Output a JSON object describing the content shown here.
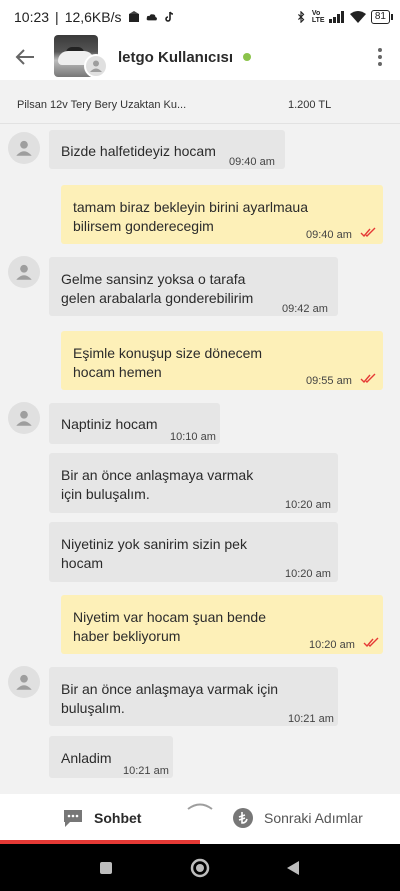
{
  "status_bar": {
    "time": "10:23",
    "network_speed": "12,6KB/s",
    "network_type": "Vo LTE",
    "battery": "81"
  },
  "header": {
    "user_name": "letgo Kullanıcısı",
    "online_color": "#8bc34a"
  },
  "listing": {
    "title": "Pilsan 12v Tery Bery Uzaktan Ku...",
    "price": "1.200 TL"
  },
  "messages": [
    {
      "direction": "in",
      "text": "Bizde halfetideyiz hocam",
      "time": "09:40 am"
    },
    {
      "direction": "out",
      "text": "tamam biraz bekleyin birini ayarlmaua bilirsem gonderecegim",
      "time": "09:40 am",
      "read": true
    },
    {
      "direction": "in",
      "text": "Gelme sansinz yoksa o tarafa gelen arabalarla gonderebilirim",
      "time": "09:42 am"
    },
    {
      "direction": "out",
      "text": "Eşimle konuşup size dönecem hocam hemen",
      "time": "09:55 am",
      "read": true
    },
    {
      "direction": "in",
      "text": "Naptiniz hocam",
      "time": "10:10 am"
    },
    {
      "direction": "in",
      "text": "Bir an önce anlaşmaya varmak için buluşalım.",
      "time": "10:20 am"
    },
    {
      "direction": "in",
      "text": "Niyetiniz yok sanirim sizin pek hocam",
      "time": "10:20 am"
    },
    {
      "direction": "out",
      "text": "Niyetim var hocam şuan bende haber bekliyorum",
      "time": "10:20 am",
      "read": true
    },
    {
      "direction": "in",
      "text": "Bir an önce anlaşmaya varmak için buluşalım.",
      "time": "10:21 am"
    },
    {
      "direction": "in",
      "text": "Anladim",
      "time": "10:21 am"
    }
  ],
  "tabs": {
    "chat_label": "Sohbet",
    "next_label": "Sonraki Adımlar",
    "active": "chat",
    "accent_color": "#e53935"
  },
  "colors": {
    "incoming_bubble": "#e6e6e6",
    "outgoing_bubble": "#fdf0b8",
    "read_tick": "#e53935"
  },
  "icons": [
    "back-arrow-icon",
    "user-icon",
    "more-vert-icon",
    "chat-bubble-icon",
    "lira-coin-icon",
    "home-square-icon",
    "home-circle-icon",
    "back-triangle-icon"
  ]
}
